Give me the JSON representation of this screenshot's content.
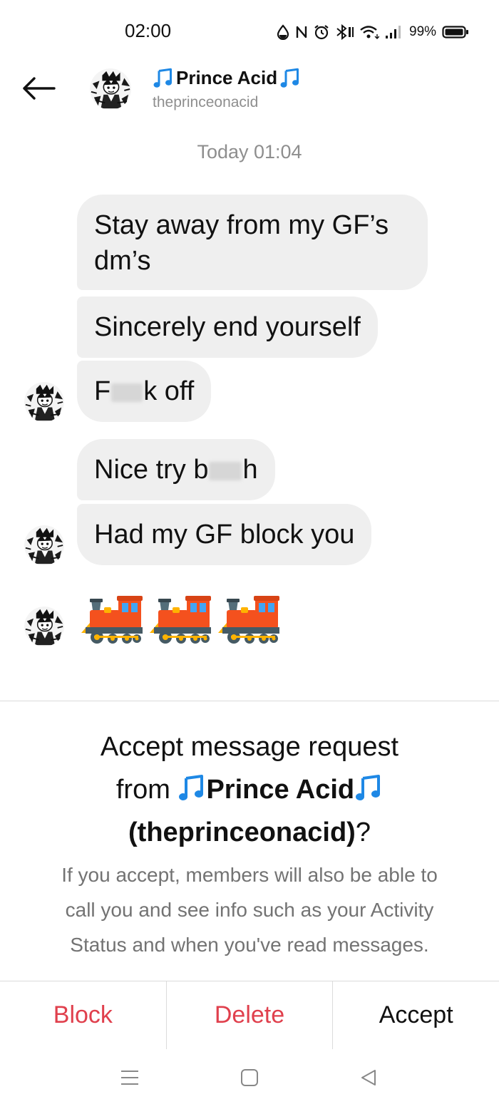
{
  "status_bar": {
    "time": "02:00",
    "battery": "99%",
    "icons": [
      "data-saver-icon",
      "nfc-icon",
      "alarm-icon",
      "bluetooth-icon",
      "wifi-icon",
      "signal-icon",
      "battery-icon"
    ]
  },
  "header": {
    "back_icon": "arrow-left-icon",
    "name": "Prince Acid",
    "name_decoration": "musical-note-emoji",
    "handle": "theprinceonacid"
  },
  "chat": {
    "timestamp": "Today 01:04",
    "messages": [
      {
        "line1": "Stay away from my GF’s",
        "line2": "dm’s"
      },
      {
        "text": "Sincerely end yourself"
      },
      {
        "before": "F",
        "after": "k off"
      },
      {
        "before": "Nice try b",
        "after": "h"
      },
      {
        "text": "Had my GF block you"
      }
    ],
    "emoji_message": [
      "locomotive-emoji",
      "locomotive-emoji",
      "locomotive-emoji"
    ]
  },
  "request": {
    "title_prefix": "Accept message request",
    "title_from": "from",
    "title_name": "Prince Acid",
    "title_handle": "(theprinceonacid)",
    "title_suffix": "?",
    "body_line1": "If you accept, members will also be able to",
    "body_line2": "call you and see info such as your Activity",
    "body_line3": "Status and when you've read messages.",
    "block_label": "Block",
    "delete_label": "Delete",
    "accept_label": "Accept"
  },
  "colors": {
    "danger": "#e0404d",
    "bubble": "#efefef",
    "muted_text": "#8e8e8e",
    "note_blue": "#1e88e5"
  },
  "navbar": {
    "icons": [
      "menu-icon",
      "home-square-icon",
      "back-triangle-icon"
    ]
  }
}
